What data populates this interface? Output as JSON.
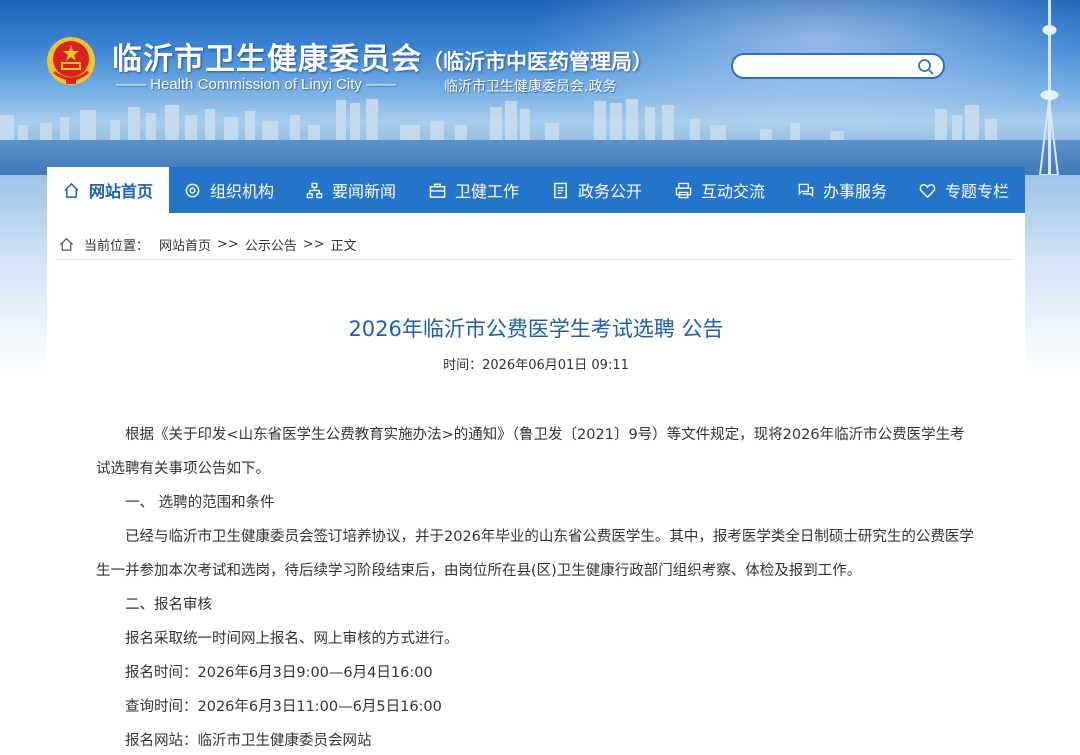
{
  "header": {
    "title_main": "临沂市卫生健康委员会",
    "title_sub": "（临沂市中医药管理局）",
    "title_en": "—— Health Commission of Linyi City ——",
    "title_cn2": "临沂市卫生健康委员会.政务",
    "search": {
      "placeholder": ""
    }
  },
  "nav": {
    "items": [
      {
        "label": "网站首页",
        "icon": "home-icon",
        "active": true
      },
      {
        "label": "组织机构",
        "icon": "org-gear-icon",
        "active": false
      },
      {
        "label": "要闻新闻",
        "icon": "org-tree-icon",
        "active": false
      },
      {
        "label": "卫健工作",
        "icon": "briefcase-icon",
        "active": false
      },
      {
        "label": "政务公开",
        "icon": "document-icon",
        "active": false
      },
      {
        "label": "互动交流",
        "icon": "print-icon",
        "active": false
      },
      {
        "label": "办事服务",
        "icon": "chat-icon",
        "active": false
      },
      {
        "label": "专题专栏",
        "icon": "heart-icon",
        "active": false
      }
    ]
  },
  "breadcrumb": {
    "prefix": "当前位置：",
    "items": [
      "网站首页",
      "公示公告",
      "正文"
    ],
    "separator": ">>"
  },
  "article": {
    "title": "2026年临沂市公费医学生考试选聘 公告",
    "time": "时间：2026年06月01日 09:11",
    "paragraphs": [
      "根据《关于印发<山东省医学生公费教育实施办法>的通知》（鲁卫发〔2021〕9号）等文件规定，现将2026年临沂市公费医学生考试选聘有关事项公告如下。",
      "一、 选聘的范围和条件",
      "已经与临沂市卫生健康委员会签订培养协议，并于2026年毕业的山东省公费医学生。其中，报考医学类全日制硕士研究生的公费医学生一并参加本次考试和选岗，待后续学习阶段结束后，由岗位所在县(区)卫生健康行政部门组织考察、体检及报到工作。",
      "二、报名审核",
      "报名采取统一时间网上报名、网上审核的方式进行。",
      "报名时间：2026年6月3日9:00—6月4日16:00",
      "查询时间：2026年6月3日11:00—6月5日16:00",
      "报名网站：临沂市卫生健康委员会网站"
    ]
  },
  "colors": {
    "nav_bg": "#2474c9",
    "nav_active_text": "#1a62b4",
    "title_color": "#1f5fa8",
    "emblem_red": "#d8231f",
    "emblem_gold": "#f2c230"
  }
}
